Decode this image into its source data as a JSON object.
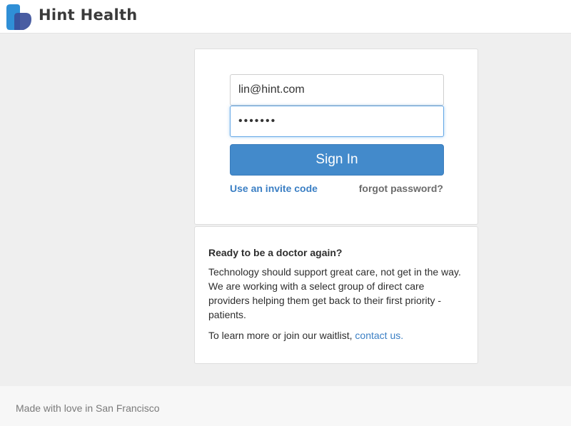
{
  "header": {
    "brand": "Hint Health",
    "logo_icon": "heart-logo-icon",
    "logo_colors": [
      "#2f8fd6",
      "#3a4f9a"
    ]
  },
  "login": {
    "email_value": "lin@hint.com",
    "password_value": "•••••••",
    "signin_label": "Sign In",
    "invite_label": "Use an invite code",
    "forgot_label": "forgot password?",
    "accent_color": "#438acb"
  },
  "info": {
    "heading": "Ready to be a doctor again?",
    "body": "Technology should support great care, not get in the way. We are working with a select group of direct care providers helping them get back to their first priority - patients.",
    "cta_prefix": "To learn more or join our waitlist, ",
    "contact_label": "contact us."
  },
  "footer": {
    "text": "Made with love in San Francisco"
  }
}
